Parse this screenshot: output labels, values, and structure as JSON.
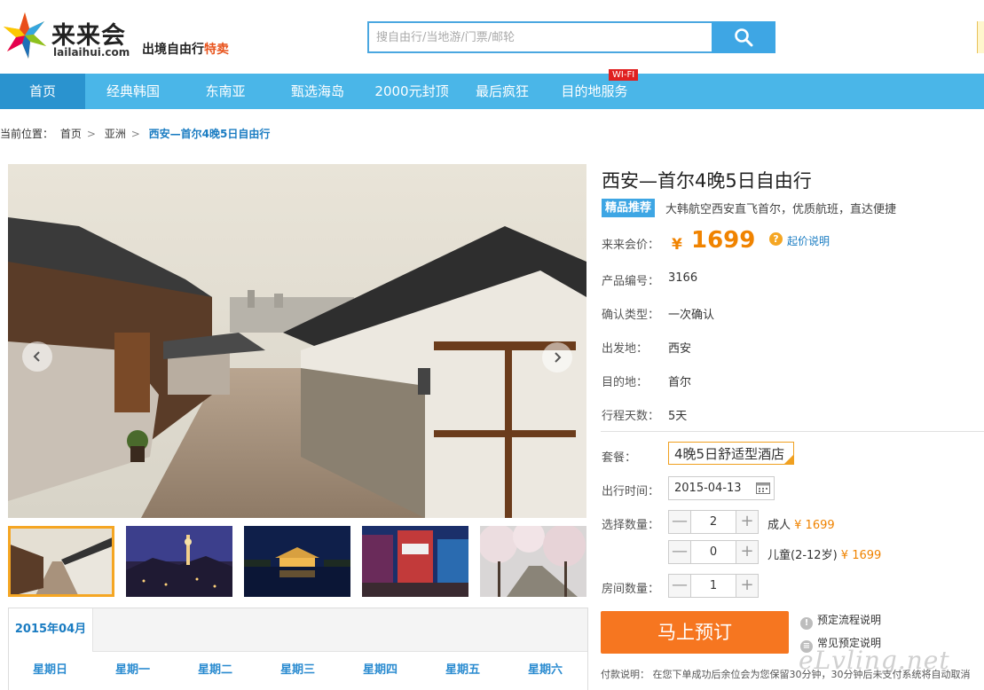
{
  "brand": {
    "name_cn": "来来会",
    "name_en": "lailaihui.com",
    "slogan_main": "出境自由行",
    "slogan_highlight": "特卖"
  },
  "search": {
    "placeholder": "搜自由行/当地游/门票/邮轮",
    "icon": "search-icon"
  },
  "nav": {
    "items": [
      "首页",
      "经典韩国",
      "东南亚",
      "甄选海岛",
      "2000元封顶",
      "最后疯狂",
      "目的地服务"
    ],
    "active_index": 0,
    "badge": "WI-FI"
  },
  "breadcrumb": {
    "prefix": "当前位置：",
    "items": [
      "首页",
      "亚洲"
    ],
    "current": "西安—首尔4晚5日自由行",
    "separator": ">"
  },
  "gallery": {
    "thumbs": [
      "bukchon-hanok-village",
      "seoul-tower-night",
      "palace-pond-night",
      "myeongdong-street-night",
      "cherry-blossom-street"
    ],
    "selected_index": 0
  },
  "calendar": {
    "month": "2015年04月",
    "weekdays": [
      "星期日",
      "星期一",
      "星期二",
      "星期三",
      "星期四",
      "星期五",
      "星期六"
    ]
  },
  "product": {
    "title": "西安—首尔4晚5日自由行",
    "tag": "精品推荐",
    "tag_desc": "大韩航空西安直飞首尔，优质航班，直达便捷",
    "price_label": "来来会价：",
    "currency": "¥",
    "price": "1699",
    "price_help_icon": "?",
    "price_link": "起价说明",
    "fields": [
      {
        "label": "产品编号：",
        "value": "3166"
      },
      {
        "label": "确认类型：",
        "value": "一次确认"
      },
      {
        "label": "出发地：",
        "value": "西安"
      },
      {
        "label": "目的地：",
        "value": "首尔"
      },
      {
        "label": "行程天数：",
        "value": "5天"
      }
    ]
  },
  "booking": {
    "package_label": "套餐：",
    "package_value": "4晚5日舒适型酒店",
    "date_label": "出行时间：",
    "date_value": "2015-04-13",
    "qty_label": "选择数量：",
    "adult_qty": "2",
    "adult_label": "成人",
    "adult_price": "¥ 1699",
    "child_qty": "0",
    "child_label": "儿童(2-12岁)",
    "child_price": "¥ 1699",
    "room_label": "房间数量：",
    "room_qty": "1",
    "minus": "—",
    "plus": "+",
    "book_button": "马上预订",
    "help_links": [
      "预定流程说明",
      "常见预定说明"
    ],
    "help_icons": [
      "!",
      "≡"
    ],
    "pay_note": "付款说明：  在您下单成功后余位会为您保留30分钟，30分钟后未支付系统将自动取消"
  },
  "watermark": "eLvling.net",
  "colors": {
    "nav_bg": "#4ab6e8",
    "nav_active": "#2a93cf",
    "price": "#f08300",
    "book_btn": "#f67620",
    "link": "#1a7cc2"
  }
}
